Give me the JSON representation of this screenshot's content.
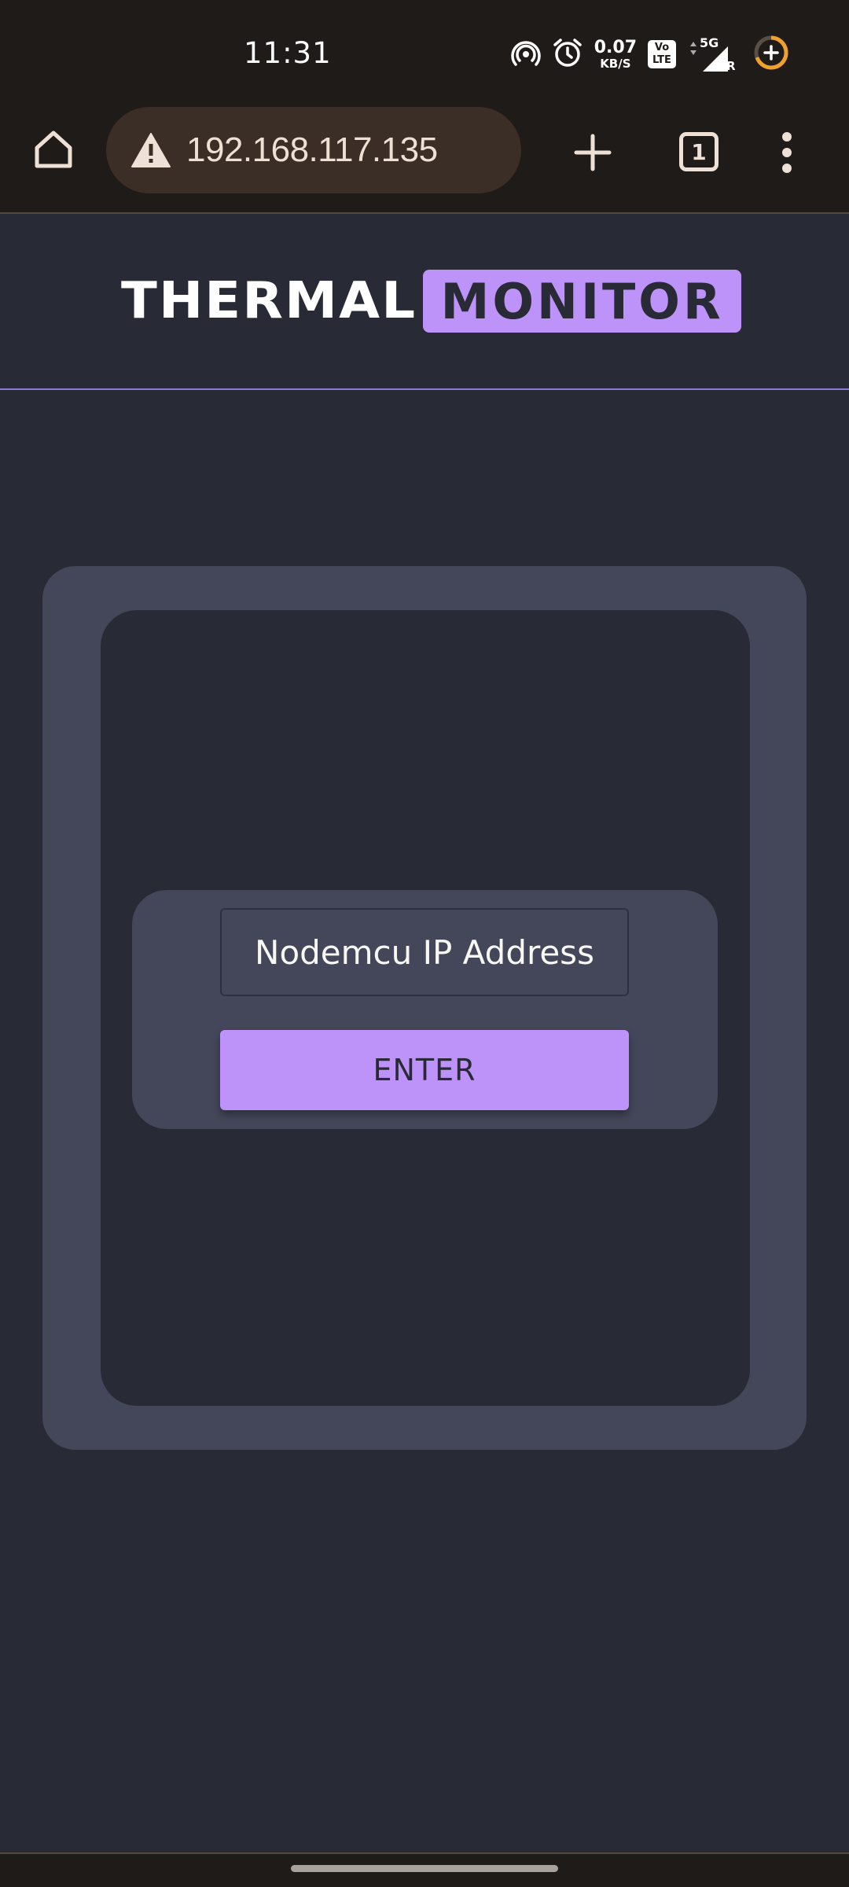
{
  "status_bar": {
    "time": "11:31",
    "speed_value": "0.07",
    "speed_unit": "KB/S",
    "volte_top": "Vo",
    "volte_bottom": "LTE",
    "network": "5G",
    "roaming": "R",
    "icons": [
      "hotspot-icon",
      "alarm-icon",
      "signal-icon",
      "battery-saver-icon"
    ]
  },
  "browser": {
    "url": "192.168.117.135",
    "tab_count": "1",
    "icons": [
      "home-icon",
      "warning-icon",
      "plus-icon",
      "more-vert-icon"
    ]
  },
  "header": {
    "brand_first": "THERMAL",
    "brand_second": "MONITOR"
  },
  "form": {
    "ip_placeholder": "Nodemcu IP Address",
    "enter_label": "ENTER"
  },
  "colors": {
    "accent": "#bd93f9",
    "background": "#282a35",
    "card": "#44475a",
    "browser_chrome": "#1f1b18"
  }
}
